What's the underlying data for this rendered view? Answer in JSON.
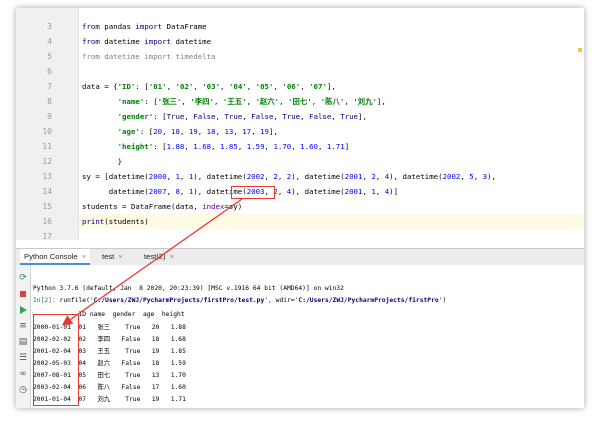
{
  "editor": {
    "lines": [
      {
        "no": "3",
        "segments": [
          [
            "kw",
            "from "
          ],
          [
            "",
            "pandas "
          ],
          [
            "kw",
            "import "
          ],
          [
            "",
            "DataFrame"
          ]
        ]
      },
      {
        "no": "4",
        "segments": [
          [
            "kw",
            "from "
          ],
          [
            "",
            "datetime "
          ],
          [
            "kw",
            "import "
          ],
          [
            "",
            "datetime"
          ]
        ]
      },
      {
        "no": "5",
        "segments": [
          [
            "uk",
            "from datetime import timedelta"
          ]
        ]
      },
      {
        "no": "6",
        "segments": []
      },
      {
        "no": "7",
        "segments": [
          [
            "",
            "data = {"
          ],
          [
            "str",
            "'ID'"
          ],
          [
            "",
            ": ["
          ],
          [
            "str",
            "'01'"
          ],
          [
            "",
            ", "
          ],
          [
            "str",
            "'02'"
          ],
          [
            "",
            ", "
          ],
          [
            "str",
            "'03'"
          ],
          [
            "",
            ", "
          ],
          [
            "str",
            "'04'"
          ],
          [
            "",
            ", "
          ],
          [
            "str",
            "'05'"
          ],
          [
            "",
            ", "
          ],
          [
            "str",
            "'06'"
          ],
          [
            "",
            ", "
          ],
          [
            "str",
            "'07'"
          ],
          [
            "",
            "],"
          ]
        ]
      },
      {
        "no": "8",
        "segments": [
          [
            "",
            "        "
          ],
          [
            "str",
            "'name'"
          ],
          [
            "",
            ": ["
          ],
          [
            "str",
            "'张三'"
          ],
          [
            "",
            ", "
          ],
          [
            "str",
            "'李四'"
          ],
          [
            "",
            ", "
          ],
          [
            "str",
            "'王五'"
          ],
          [
            "",
            ", "
          ],
          [
            "str",
            "'赵六'"
          ],
          [
            "",
            ", "
          ],
          [
            "str",
            "'田七'"
          ],
          [
            "",
            ", "
          ],
          [
            "str",
            "'陈八'"
          ],
          [
            "",
            ", "
          ],
          [
            "str",
            "'刘九'"
          ],
          [
            "",
            "],"
          ]
        ]
      },
      {
        "no": "9",
        "segments": [
          [
            "",
            "        "
          ],
          [
            "str",
            "'gender'"
          ],
          [
            "",
            ": ["
          ],
          [
            "kw",
            "True"
          ],
          [
            "",
            ", "
          ],
          [
            "kw",
            "False"
          ],
          [
            "",
            ", "
          ],
          [
            "kw",
            "True"
          ],
          [
            "",
            ", "
          ],
          [
            "kw",
            "False"
          ],
          [
            "",
            ", "
          ],
          [
            "kw",
            "True"
          ],
          [
            "",
            ", "
          ],
          [
            "kw",
            "False"
          ],
          [
            "",
            ", "
          ],
          [
            "kw",
            "True"
          ],
          [
            "",
            "],"
          ]
        ]
      },
      {
        "no": "10",
        "segments": [
          [
            "",
            "        "
          ],
          [
            "str",
            "'age'"
          ],
          [
            "",
            ": ["
          ],
          [
            "num",
            "20"
          ],
          [
            "",
            ", "
          ],
          [
            "num",
            "18"
          ],
          [
            "",
            ", "
          ],
          [
            "num",
            "19"
          ],
          [
            "",
            ", "
          ],
          [
            "num",
            "18"
          ],
          [
            "",
            ", "
          ],
          [
            "num",
            "13"
          ],
          [
            "",
            ", "
          ],
          [
            "num",
            "17"
          ],
          [
            "",
            ", "
          ],
          [
            "num",
            "19"
          ],
          [
            "",
            "],"
          ]
        ]
      },
      {
        "no": "11",
        "segments": [
          [
            "",
            "        "
          ],
          [
            "str",
            "'height'"
          ],
          [
            "",
            ": ["
          ],
          [
            "num",
            "1.88"
          ],
          [
            "",
            ", "
          ],
          [
            "num",
            "1.68"
          ],
          [
            "",
            ", "
          ],
          [
            "num",
            "1.85"
          ],
          [
            "",
            ", "
          ],
          [
            "num",
            "1.59"
          ],
          [
            "",
            ", "
          ],
          [
            "num",
            "1.70"
          ],
          [
            "",
            ", "
          ],
          [
            "num",
            "1.60"
          ],
          [
            "",
            ", "
          ],
          [
            "num",
            "1.71"
          ],
          [
            "",
            "]"
          ]
        ]
      },
      {
        "no": "12",
        "segments": [
          [
            "",
            "        }"
          ]
        ]
      },
      {
        "no": "13",
        "segments": [
          [
            "",
            "sy = [datetime("
          ],
          [
            "num",
            "2000"
          ],
          [
            "",
            ", "
          ],
          [
            "num",
            "1"
          ],
          [
            "",
            ", "
          ],
          [
            "num",
            "1"
          ],
          [
            "",
            "), datetime("
          ],
          [
            "num",
            "2002"
          ],
          [
            "",
            ", "
          ],
          [
            "num",
            "2"
          ],
          [
            "",
            ", "
          ],
          [
            "num",
            "2"
          ],
          [
            "",
            "), datetime("
          ],
          [
            "num",
            "2001"
          ],
          [
            "",
            ", "
          ],
          [
            "num",
            "2"
          ],
          [
            "",
            ", "
          ],
          [
            "num",
            "4"
          ],
          [
            "",
            "), datetime("
          ],
          [
            "num",
            "2002"
          ],
          [
            "",
            ", "
          ],
          [
            "num",
            "5"
          ],
          [
            "",
            ", "
          ],
          [
            "num",
            "3"
          ],
          [
            "",
            "),"
          ]
        ]
      },
      {
        "no": "14",
        "segments": [
          [
            "",
            "      datetime("
          ],
          [
            "num",
            "2007"
          ],
          [
            "",
            ", "
          ],
          [
            "num",
            "8"
          ],
          [
            "",
            ", "
          ],
          [
            "num",
            "1"
          ],
          [
            "",
            "), datetime("
          ],
          [
            "num",
            "2003"
          ],
          [
            "",
            ", "
          ],
          [
            "num",
            "2"
          ],
          [
            "",
            ", "
          ],
          [
            "num",
            "4"
          ],
          [
            "",
            "), datetime("
          ],
          [
            "num",
            "2001"
          ],
          [
            "",
            ", "
          ],
          [
            "num",
            "1"
          ],
          [
            "",
            ", "
          ],
          [
            "num",
            "4"
          ],
          [
            "",
            ")]"
          ]
        ]
      },
      {
        "no": "15",
        "segments": [
          [
            "",
            "students = DataFrame(data, "
          ],
          [
            "key",
            "index"
          ],
          [
            "",
            "=sy)"
          ]
        ]
      },
      {
        "no": "16",
        "segments": [
          [
            "kw",
            "print"
          ],
          [
            "",
            "(students)"
          ]
        ]
      },
      {
        "no": "17",
        "segments": []
      }
    ]
  },
  "tabs": [
    {
      "label": "Python Console",
      "close": "×"
    },
    {
      "label": "test",
      "close": "×"
    },
    {
      "label": "test(2)",
      "close": "×"
    }
  ],
  "console": {
    "banner": "Python 3.7.6 (default, Jan  8 2020, 20:23:39) [MSC v.1916 64 bit (AMD64)] on win32",
    "prompt": "In[2]:",
    "command_pre": " runfile('",
    "command_path": "C:/Users/ZWJ/PycharmProjects/firstPro/test.py",
    "command_mid": "', wdir='",
    "command_wdir": "C:/Users/ZWJ/PycharmProjects/firstPro",
    "command_post": "')",
    "header": "            ID name  gender  age  height",
    "rows": [
      "2000-01-01  01   张三    True   20   1.88",
      "2002-02-02  02   李四   False   18   1.68",
      "2001-02-04  03   王五    True   19   1.85",
      "2002-05-03  04   赵六   False   18   1.59",
      "2007-08-01  05   田七    True   13   1.70",
      "2003-02-04  06   陈八   False   17   1.60",
      "2001-01-04  07   刘九    True   19   1.71"
    ]
  },
  "icons": {
    "rerun": "rerun-icon",
    "stop": "stop-icon",
    "run": "run-icon",
    "variables": "variables-icon",
    "print": "print-icon",
    "wrap": "soft-wrap-icon",
    "history": "history-icon",
    "settings": "settings-icon"
  },
  "colors": {
    "annotation_red": "#e53935",
    "current_line": "#fffae3",
    "keyword": "#000080",
    "string": "#008000",
    "number": "#0000ff"
  }
}
